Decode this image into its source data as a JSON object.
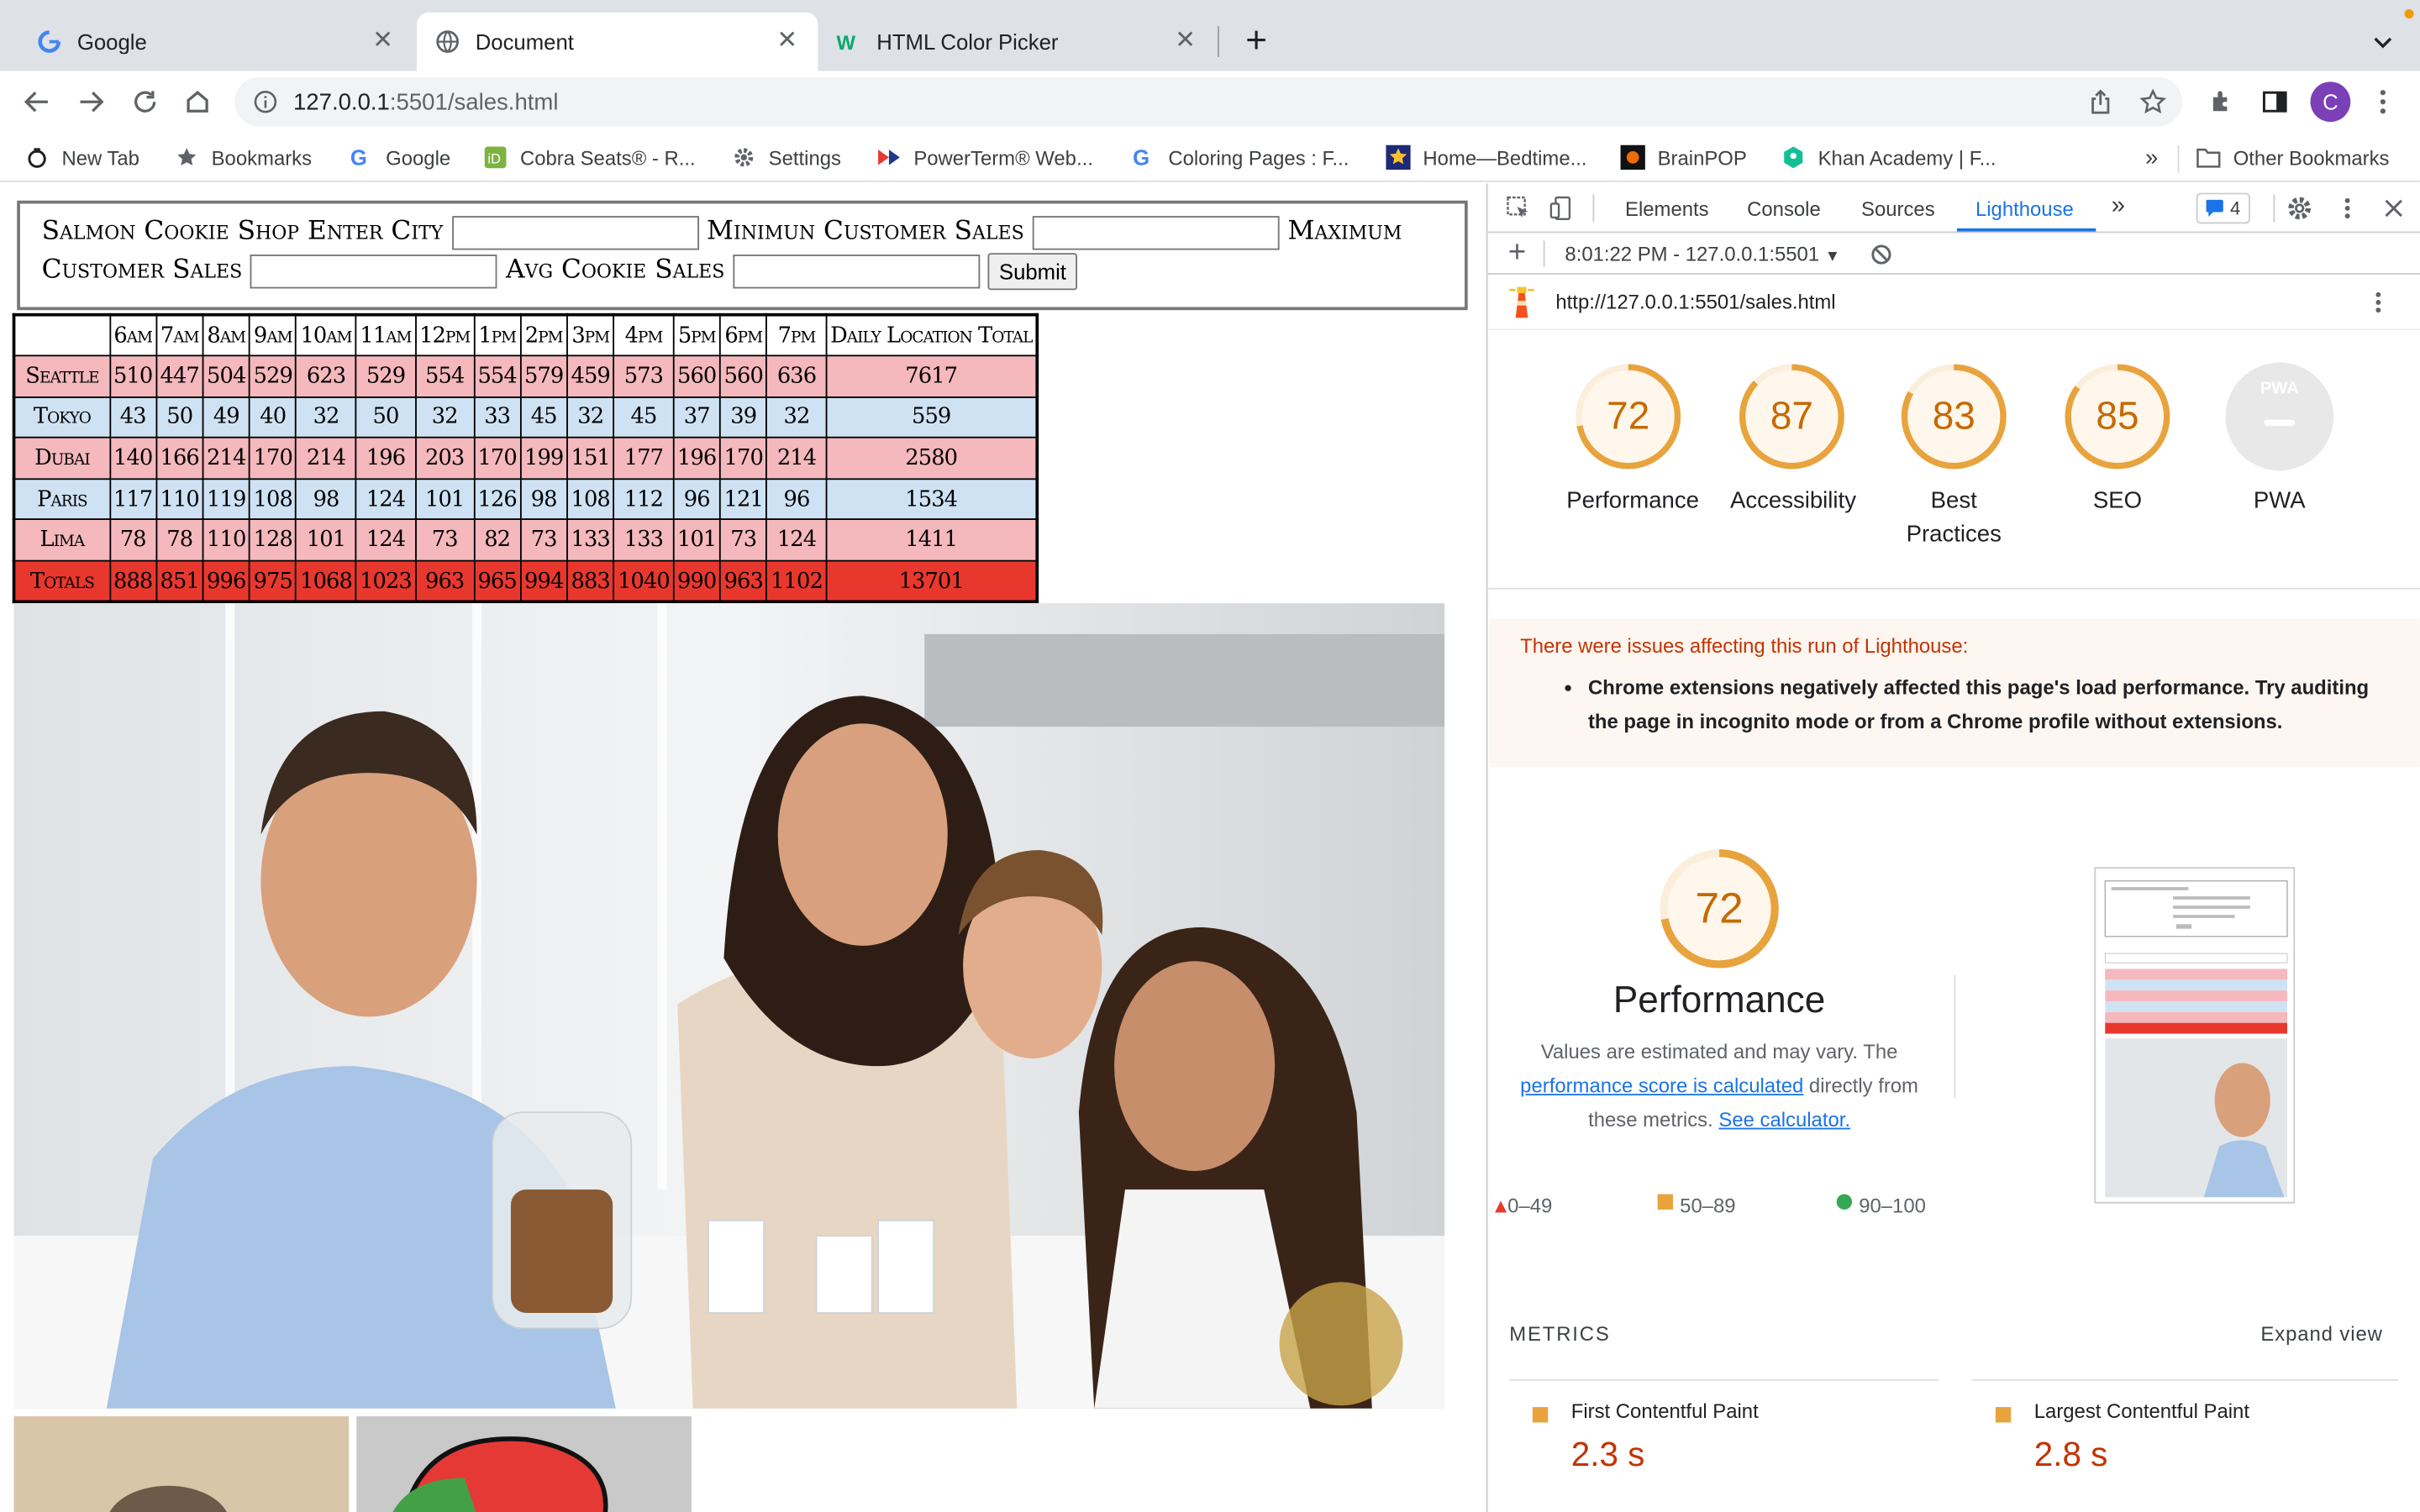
{
  "browser": {
    "tabs": [
      {
        "title": "Google",
        "icon": "google-g-icon",
        "active": false
      },
      {
        "title": "Document",
        "icon": "globe-icon",
        "active": true
      },
      {
        "title": "HTML Color Picker",
        "icon": "w3schools-icon",
        "active": false
      }
    ],
    "url_host": "127.0.0.1",
    "url_path": ":5501/sales.html",
    "profile_initial": "C",
    "bookmarks": [
      {
        "label": "New Tab",
        "icon": "newtab-icon"
      },
      {
        "label": "Bookmarks",
        "icon": "star-icon"
      },
      {
        "label": "Google",
        "icon": "google-g-icon"
      },
      {
        "label": "Cobra Seats® - R...",
        "icon": "cobra-icon"
      },
      {
        "label": "Settings",
        "icon": "gear-icon"
      },
      {
        "label": "PowerTerm® Web...",
        "icon": "powerterm-icon"
      },
      {
        "label": "Coloring Pages : F...",
        "icon": "google-g-icon"
      },
      {
        "label": "Home—Bedtime...",
        "icon": "bedtime-star-icon"
      },
      {
        "label": "BrainPOP",
        "icon": "brainpop-icon"
      },
      {
        "label": "Khan Academy | F...",
        "icon": "khan-icon"
      }
    ],
    "more_bookmarks": "»",
    "other_bookmarks": "Other Bookmarks"
  },
  "page": {
    "form": {
      "title": "Salmon Cookie Shop",
      "enter_city_label": "Enter City",
      "min_label": "Minimun Customer Sales",
      "max_label": "Maximum Customer Sales",
      "avg_label": "Avg Cookie Sales",
      "submit": "Submit"
    },
    "table": {
      "headers": [
        "",
        "6am",
        "7am",
        "8am",
        "9am",
        "10am",
        "11am",
        "12pm",
        "1pm",
        "2pm",
        "3pm",
        "4pm",
        "5pm",
        "6pm",
        "7pm",
        "Daily Location Total"
      ],
      "rows": [
        {
          "city": "Seattle",
          "values": [
            "510",
            "447",
            "504",
            "529",
            "623",
            "529",
            "554",
            "554",
            "579",
            "459",
            "573",
            "560",
            "560",
            "636"
          ],
          "total": "7617",
          "style": "pink"
        },
        {
          "city": "Tokyo",
          "values": [
            "43",
            "50",
            "49",
            "40",
            "32",
            "50",
            "32",
            "33",
            "45",
            "32",
            "45",
            "37",
            "39",
            "32"
          ],
          "total": "559",
          "style": "blue"
        },
        {
          "city": "Dubai",
          "values": [
            "140",
            "166",
            "214",
            "170",
            "214",
            "196",
            "203",
            "170",
            "199",
            "151",
            "177",
            "196",
            "170",
            "214"
          ],
          "total": "2580",
          "style": "pink"
        },
        {
          "city": "Paris",
          "values": [
            "117",
            "110",
            "119",
            "108",
            "98",
            "124",
            "101",
            "126",
            "98",
            "108",
            "112",
            "96",
            "121",
            "96"
          ],
          "total": "1534",
          "style": "blue"
        },
        {
          "city": "Lima",
          "values": [
            "78",
            "78",
            "110",
            "128",
            "101",
            "124",
            "73",
            "82",
            "73",
            "133",
            "133",
            "101",
            "73",
            "124"
          ],
          "total": "1411",
          "style": "pink"
        }
      ],
      "totals": {
        "label": "Totals",
        "values": [
          "888",
          "851",
          "996",
          "975",
          "1068",
          "1023",
          "963",
          "965",
          "994",
          "883",
          "1040",
          "990",
          "963",
          "1102"
        ],
        "total": "13701"
      }
    }
  },
  "devtools": {
    "tabs": [
      "Elements",
      "Console",
      "Sources",
      "Lighthouse"
    ],
    "active_tab": "Lighthouse",
    "more_tabs": "»",
    "issues_count": "4",
    "run_label": "8:01:22 PM - 127.0.0.1:5501",
    "report_url": "http://127.0.0.1:5501/sales.html",
    "scores": [
      {
        "label": "Performance",
        "value": "72",
        "score": 72
      },
      {
        "label": "Accessibility",
        "value": "87",
        "score": 87
      },
      {
        "label": "Best Practices",
        "value": "83",
        "score": 83
      },
      {
        "label": "SEO",
        "value": "85",
        "score": 85
      },
      {
        "label": "PWA",
        "value": "PWA",
        "score": 0
      }
    ],
    "warning_title": "There were issues affecting this run of Lighthouse:",
    "warning_item": "Chrome extensions negatively affected this page's load performance. Try auditing the page in incognito mode or from a Chrome profile without extensions.",
    "perf_score": "72",
    "perf_title": "Performance",
    "perf_desc_1": "Values are estimated and may vary. The",
    "perf_link_1": "performance score is calculated",
    "perf_desc_2": "directly from these metrics.",
    "perf_link_2": "See calculator.",
    "legend": [
      "0–49",
      "50–89",
      "90–100"
    ],
    "metrics_title": "METRICS",
    "expand_view": "Expand view",
    "metrics": [
      {
        "name": "First Contentful Paint",
        "value": "2.3 s"
      },
      {
        "name": "Largest Contentful Paint",
        "value": "2.8 s"
      }
    ],
    "colors": {
      "average": "#e8a33d",
      "fail": "#e8382e",
      "pass": "#34a853",
      "accent": "#1a73e8"
    }
  }
}
